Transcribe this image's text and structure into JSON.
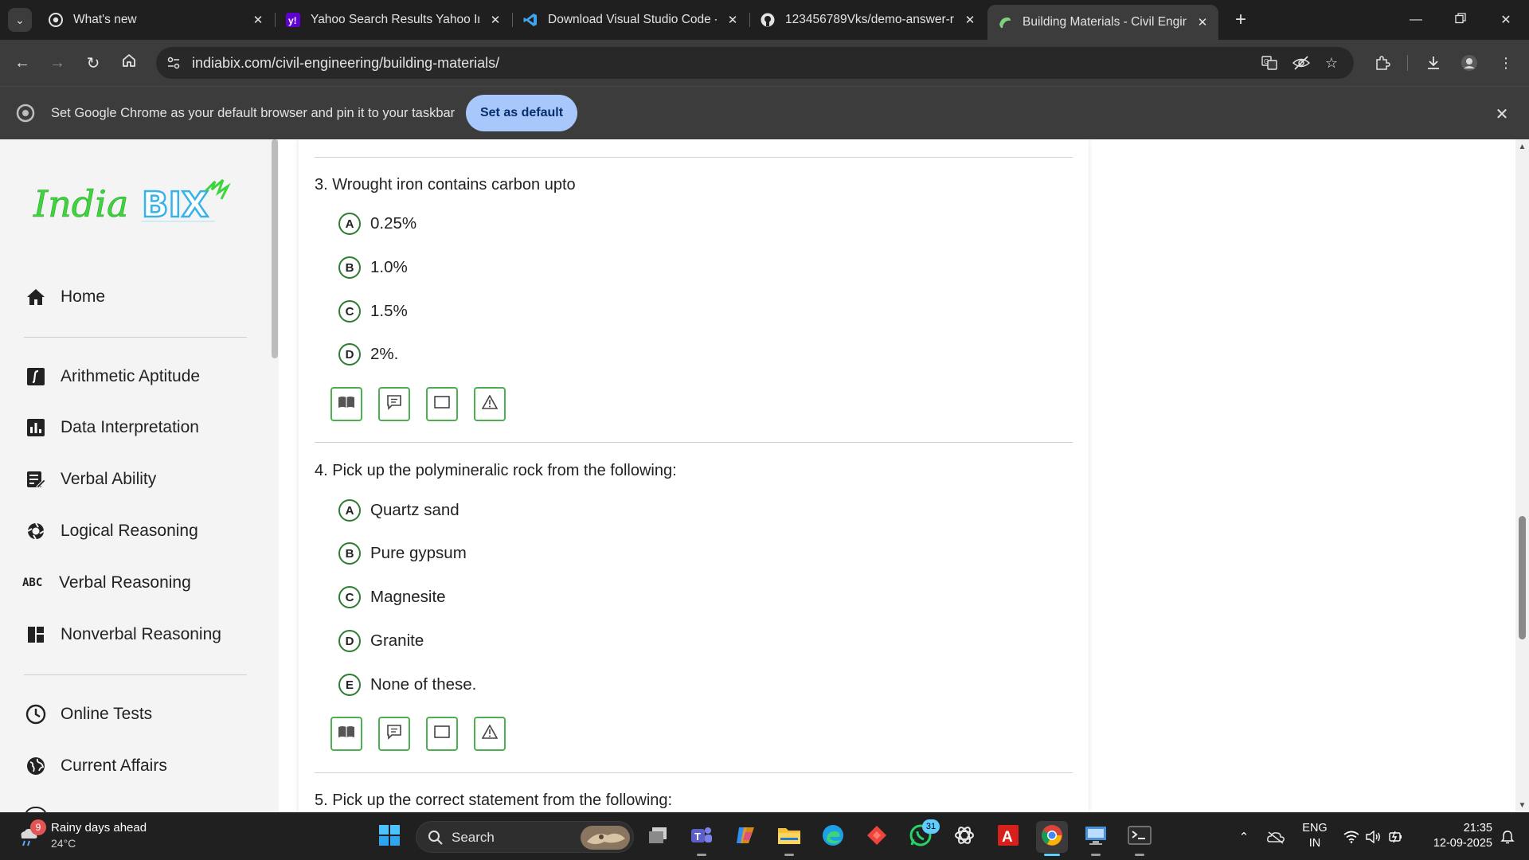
{
  "browser": {
    "tabs": [
      {
        "title": "What's new",
        "icon": "chrome-icon"
      },
      {
        "title": "Yahoo Search Results Yahoo Ind",
        "icon": "yahoo-icon"
      },
      {
        "title": "Download Visual Studio Code -",
        "icon": "vscode-icon"
      },
      {
        "title": "123456789Vks/demo-answer-r",
        "icon": "github-icon"
      },
      {
        "title": "Building Materials - Civil Engine",
        "icon": "indiabix-icon",
        "active": true
      }
    ],
    "url": "indiabix.com/civil-engineering/building-materials/",
    "infobar": {
      "message": "Set Google Chrome as your default browser and pin it to your taskbar",
      "button": "Set as default"
    }
  },
  "sidebar": {
    "logo": "IndiaBIX",
    "items": [
      {
        "label": "Home",
        "icon": "home-icon"
      },
      {
        "label": "Arithmetic Aptitude",
        "icon": "math-icon"
      },
      {
        "label": "Data Interpretation",
        "icon": "bar-chart-icon"
      },
      {
        "label": "Verbal Ability",
        "icon": "edit-note-icon"
      },
      {
        "label": "Logical Reasoning",
        "icon": "logic-icon"
      },
      {
        "label": "Verbal Reasoning",
        "icon": "abc-icon",
        "glyph": "ABC"
      },
      {
        "label": "Nonverbal Reasoning",
        "icon": "dashboard-icon"
      },
      {
        "label": "Online Tests",
        "icon": "clock-icon"
      },
      {
        "label": "Current Affairs",
        "icon": "globe-icon"
      }
    ]
  },
  "questions": [
    {
      "number": "3.",
      "text": "Wrought iron contains carbon upto",
      "options": [
        {
          "letter": "A",
          "text": "0.25%"
        },
        {
          "letter": "B",
          "text": "1.0%"
        },
        {
          "letter": "C",
          "text": "1.5%"
        },
        {
          "letter": "D",
          "text": "2%."
        }
      ]
    },
    {
      "number": "4.",
      "text": "Pick up the polymineralic rock from the following:",
      "options": [
        {
          "letter": "A",
          "text": "Quartz sand"
        },
        {
          "letter": "B",
          "text": "Pure gypsum"
        },
        {
          "letter": "C",
          "text": "Magnesite"
        },
        {
          "letter": "D",
          "text": "Granite"
        },
        {
          "letter": "E",
          "text": "None of these."
        }
      ]
    },
    {
      "number": "5.",
      "text": "Pick up the correct statement from the following:",
      "options": []
    }
  ],
  "question_actions": [
    "answer-book-icon",
    "discuss-icon",
    "workspace-icon",
    "report-icon"
  ],
  "taskbar": {
    "weather": {
      "badge": "9",
      "condition": "Rainy days ahead",
      "temp": "24°C"
    },
    "search_label": "Search",
    "whatsapp_badge": "31",
    "lang_line1": "ENG",
    "lang_line2": "IN",
    "time": "21:35",
    "date": "12-09-2025"
  },
  "colors": {
    "option_border": "#2e7d32",
    "action_border": "#4caf50",
    "set_default_bg": "#a8c7fa",
    "chrome_dark": "#1f1f1f"
  }
}
